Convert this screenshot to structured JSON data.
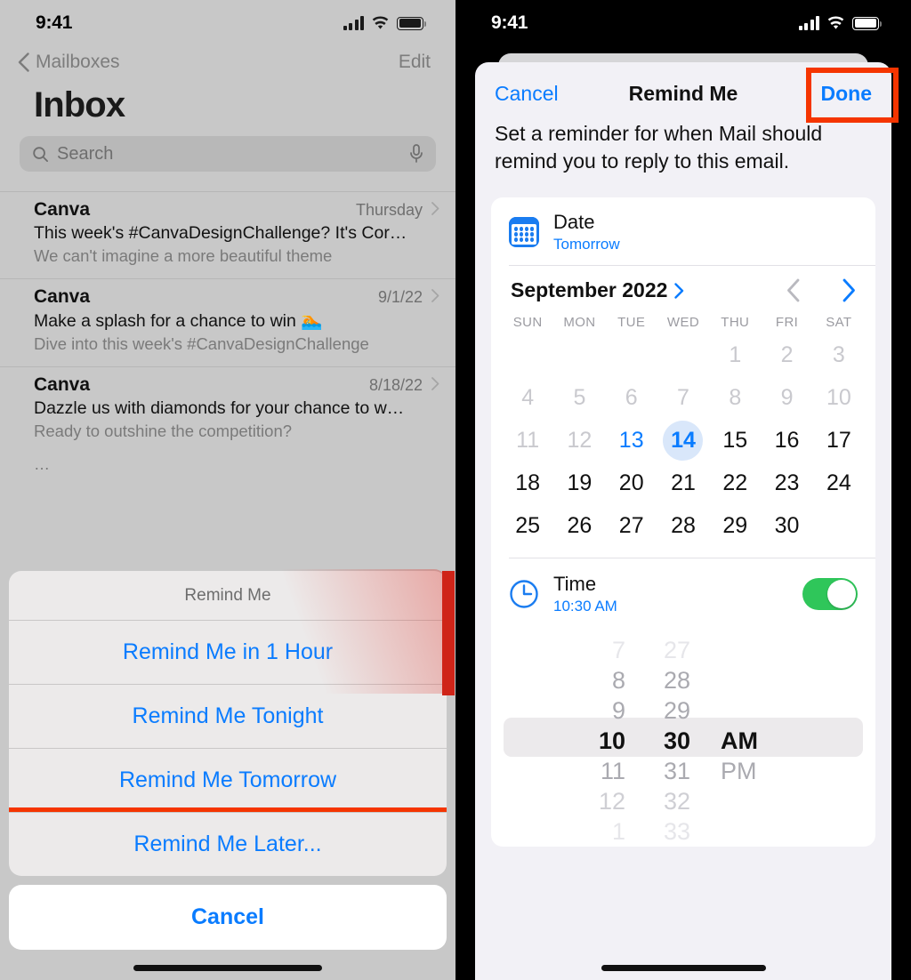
{
  "left": {
    "status": {
      "time": "9:41",
      "signal_icon": "cellular-signal-icon",
      "wifi_icon": "wifi-icon",
      "battery_icon": "battery-icon"
    },
    "nav": {
      "back_label": "Mailboxes",
      "edit_label": "Edit"
    },
    "title": "Inbox",
    "search": {
      "placeholder": "Search",
      "value": "",
      "icon": "search-icon",
      "mic_icon": "microphone-icon"
    },
    "mails": [
      {
        "sender": "Canva",
        "date": "Thursday",
        "subject": "This week's #CanvaDesignChallenge? It's Cor…",
        "preview": "We can't imagine a more beautiful theme"
      },
      {
        "sender": "Canva",
        "date": "9/1/22",
        "subject": "Make a splash for a chance to win 🏊",
        "preview": "Dive into this week's #CanvaDesignChallenge"
      },
      {
        "sender": "Canva",
        "date": "8/18/22",
        "subject": "Dazzle us with diamonds for your chance to w…",
        "preview": "Ready to outshine the competition?"
      }
    ],
    "list_overflow": "…",
    "action_sheet": {
      "title": "Remind Me",
      "items": [
        {
          "label": "Remind Me in 1 Hour",
          "highlighted": false
        },
        {
          "label": "Remind Me Tonight",
          "highlighted": false
        },
        {
          "label": "Remind Me Tomorrow",
          "highlighted": false
        },
        {
          "label": "Remind Me Later...",
          "highlighted": true
        }
      ],
      "cancel_label": "Cancel"
    }
  },
  "right": {
    "status": {
      "time": "9:41",
      "signal_icon": "cellular-signal-icon",
      "wifi_icon": "wifi-icon",
      "battery_icon": "battery-icon"
    },
    "navbar": {
      "cancel_label": "Cancel",
      "title": "Remind Me",
      "done_label": "Done",
      "done_highlighted": true
    },
    "description": "Set a reminder for when Mail should remind you to reply to this email.",
    "date_row": {
      "icon": "calendar-icon",
      "label": "Date",
      "value": "Tomorrow"
    },
    "calendar": {
      "month_label": "September 2022",
      "month_chevron_icon": "chevron-right-icon",
      "prev_icon": "chevron-left-icon",
      "next_icon": "chevron-right-icon",
      "weekdays": [
        "SUN",
        "MON",
        "TUE",
        "WED",
        "THU",
        "FRI",
        "SAT"
      ],
      "leading_blanks": 4,
      "cells": [
        {
          "d": "1",
          "state": "dim"
        },
        {
          "d": "2",
          "state": "dim"
        },
        {
          "d": "3",
          "state": "dim"
        },
        {
          "d": "4",
          "state": "dim"
        },
        {
          "d": "5",
          "state": "dim"
        },
        {
          "d": "6",
          "state": "dim"
        },
        {
          "d": "7",
          "state": "dim"
        },
        {
          "d": "8",
          "state": "dim"
        },
        {
          "d": "9",
          "state": "dim"
        },
        {
          "d": "10",
          "state": "dim"
        },
        {
          "d": "11",
          "state": "dim"
        },
        {
          "d": "12",
          "state": "dim"
        },
        {
          "d": "13",
          "state": "today"
        },
        {
          "d": "14",
          "state": "sel"
        },
        {
          "d": "15",
          "state": "normal"
        },
        {
          "d": "16",
          "state": "normal"
        },
        {
          "d": "17",
          "state": "normal"
        },
        {
          "d": "18",
          "state": "normal"
        },
        {
          "d": "19",
          "state": "normal"
        },
        {
          "d": "20",
          "state": "normal"
        },
        {
          "d": "21",
          "state": "normal"
        },
        {
          "d": "22",
          "state": "normal"
        },
        {
          "d": "23",
          "state": "normal"
        },
        {
          "d": "24",
          "state": "normal"
        },
        {
          "d": "25",
          "state": "normal"
        },
        {
          "d": "26",
          "state": "normal"
        },
        {
          "d": "27",
          "state": "normal"
        },
        {
          "d": "28",
          "state": "normal"
        },
        {
          "d": "29",
          "state": "normal"
        },
        {
          "d": "30",
          "state": "normal"
        }
      ]
    },
    "time_row": {
      "icon": "clock-icon",
      "label": "Time",
      "value": "10:30 AM",
      "toggle_on": true
    },
    "time_picker": {
      "hours": [
        "7",
        "8",
        "9",
        "10",
        "11",
        "12",
        "1"
      ],
      "minutes": [
        "27",
        "28",
        "29",
        "30",
        "31",
        "32",
        "33"
      ],
      "meridiem": [
        "",
        "",
        "",
        "AM",
        "PM",
        "",
        ""
      ],
      "selected_hour": "10",
      "selected_minute": "30",
      "selected_meridiem": "AM"
    }
  },
  "colors": {
    "accent_blue": "#0a7cff",
    "highlight_red": "#f53500",
    "toggle_green": "#2fc65a",
    "selected_day_bg": "#d9e7fa"
  }
}
